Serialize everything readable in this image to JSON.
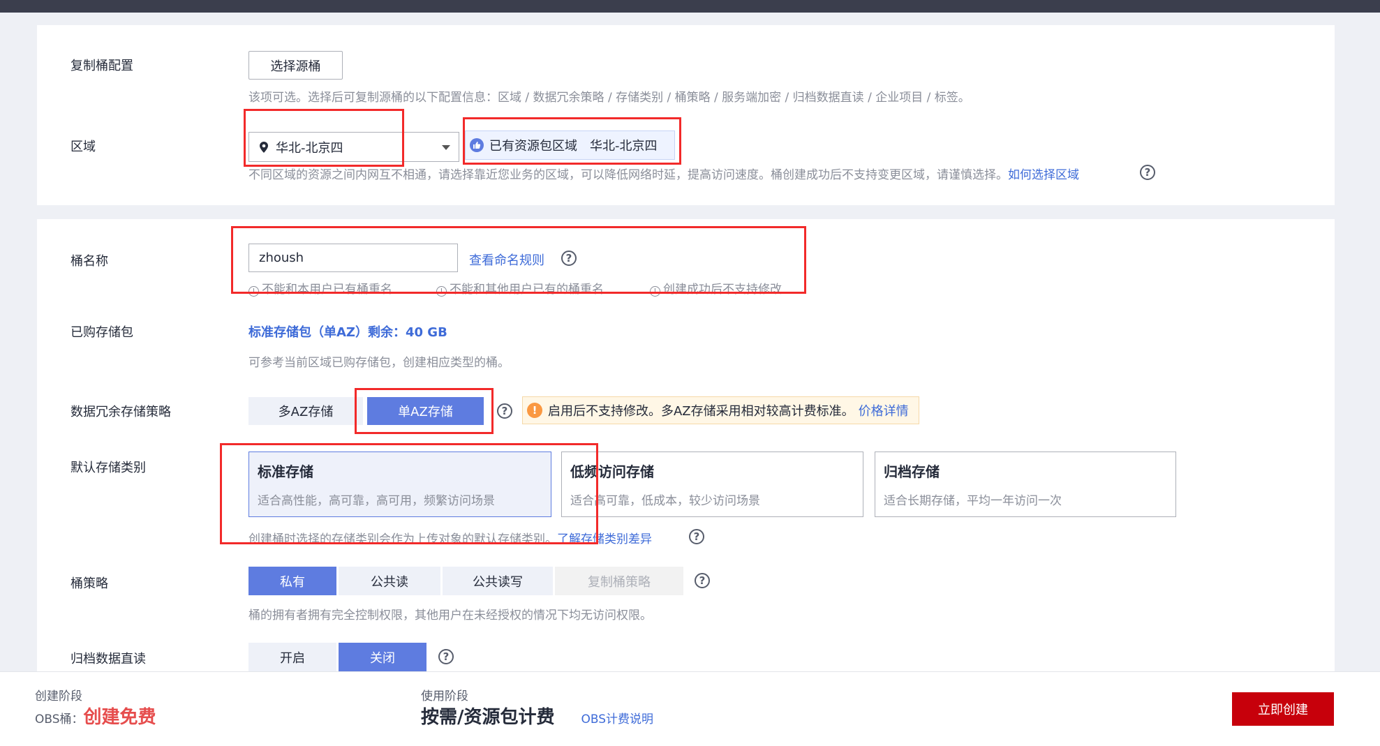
{
  "replica": {
    "label": "复制桶配置",
    "button": "选择源桶",
    "hint": "该项可选。选择后可复制源桶的以下配置信息：区域 / 数据冗余策略 / 存储类别 / 桶策略 / 服务端加密 / 归档数据直读 / 企业项目 / 标签。"
  },
  "region": {
    "label": "区域",
    "selected": "华北-北京四",
    "badge_text": "已有资源包区域",
    "badge_region": "华北-北京四",
    "hint": "不同区域的资源之间内网互不相通，请选择靠近您业务的区域，可以降低网络时延，提高访问速度。桶创建成功后不支持变更区域，请谨慎选择。",
    "hint_link": "如何选择区域"
  },
  "bucket_name": {
    "label": "桶名称",
    "value": "zhoush",
    "rule_link": "查看命名规则",
    "rules": [
      "不能和本用户已有桶重名",
      "不能和其他用户已有的桶重名",
      "创建成功后不支持修改"
    ]
  },
  "package": {
    "label": "已购存储包",
    "value": "标准存储包（单AZ）剩余：40 GB",
    "hint": "可参考当前区域已购存储包，创建相应类型的桶。"
  },
  "redundancy": {
    "label": "数据冗余存储策略",
    "options": [
      "多AZ存储",
      "单AZ存储"
    ],
    "warning": "启用后不支持修改。多AZ存储采用相对较高计费标准。",
    "warning_link": "价格详情"
  },
  "storage_class": {
    "label": "默认存储类别",
    "cards": [
      {
        "title": "标准存储",
        "desc": "适合高性能，高可靠，高可用，频繁访问场景"
      },
      {
        "title": "低频访问存储",
        "desc": "适合高可靠，低成本，较少访问场景"
      },
      {
        "title": "归档存储",
        "desc": "适合长期存储，平均一年访问一次"
      }
    ],
    "hint": "创建桶时选择的存储类别会作为上传对象的默认存储类别。",
    "hint_link": "了解存储类别差异"
  },
  "policy": {
    "label": "桶策略",
    "options": [
      "私有",
      "公共读",
      "公共读写",
      "复制桶策略"
    ],
    "hint": "桶的拥有者拥有完全控制权限，其他用户在未经授权的情况下均无访问权限。"
  },
  "archive_read": {
    "label": "归档数据直读",
    "options": [
      "开启",
      "关闭"
    ]
  },
  "footer": {
    "create_stage_label": "创建阶段",
    "obs_label": "OBS桶：",
    "create_free": "创建免费",
    "use_stage_label": "使用阶段",
    "billing": "按需/资源包计费",
    "billing_link": "OBS计费说明",
    "create_button": "立即创建"
  },
  "colors": {
    "primary": "#5e7ce0",
    "link": "#3e6bd8",
    "danger": "#c7000b",
    "highlight": "#f22a2a"
  }
}
